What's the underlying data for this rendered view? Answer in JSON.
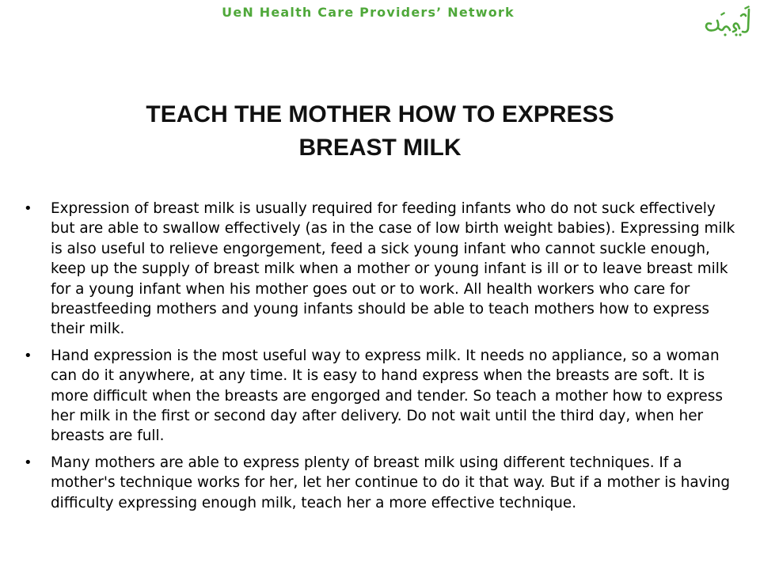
{
  "header": {
    "network_name": "UeN Health Care Providers’ Network",
    "logo_text": "اُمیدِنو",
    "logo_icon": "urdu-calligraphy-logo",
    "accent_color": "#4fa83a"
  },
  "slide": {
    "title_line1": "TEACH THE MOTHER HOW TO EXPRESS",
    "title_line2": "BREAST MILK",
    "bullet_symbol": "•",
    "bullets": [
      "Expression of breast milk is usually required for feeding infants who do not suck effectively but are able to swallow effectively (as in the case of low birth weight babies). Expressing milk is also useful to relieve engorgement, feed a sick young infant who cannot suckle enough, keep up the supply of breast milk when a mother or young infant is ill or to leave breast milk for a young infant when his mother goes out or to work.  All health workers who care for breastfeeding mothers and young infants should be able to teach mothers how to express their milk.",
      "Hand expression is the most useful way to express milk. It needs no appliance, so a woman can do it anywhere, at any time. It is easy to hand express when the breasts are soft. It is more difficult when the breasts are engorged and tender. So teach a mother how to express her milk in the first or second day after delivery. Do not wait until the third day, when her breasts are full.",
      "Many mothers are able to express plenty of breast milk using different techniques. If a mother's technique works for her, let her continue to do it that way. But if a mother is having difficulty expressing enough milk, teach her a more effective technique."
    ]
  }
}
